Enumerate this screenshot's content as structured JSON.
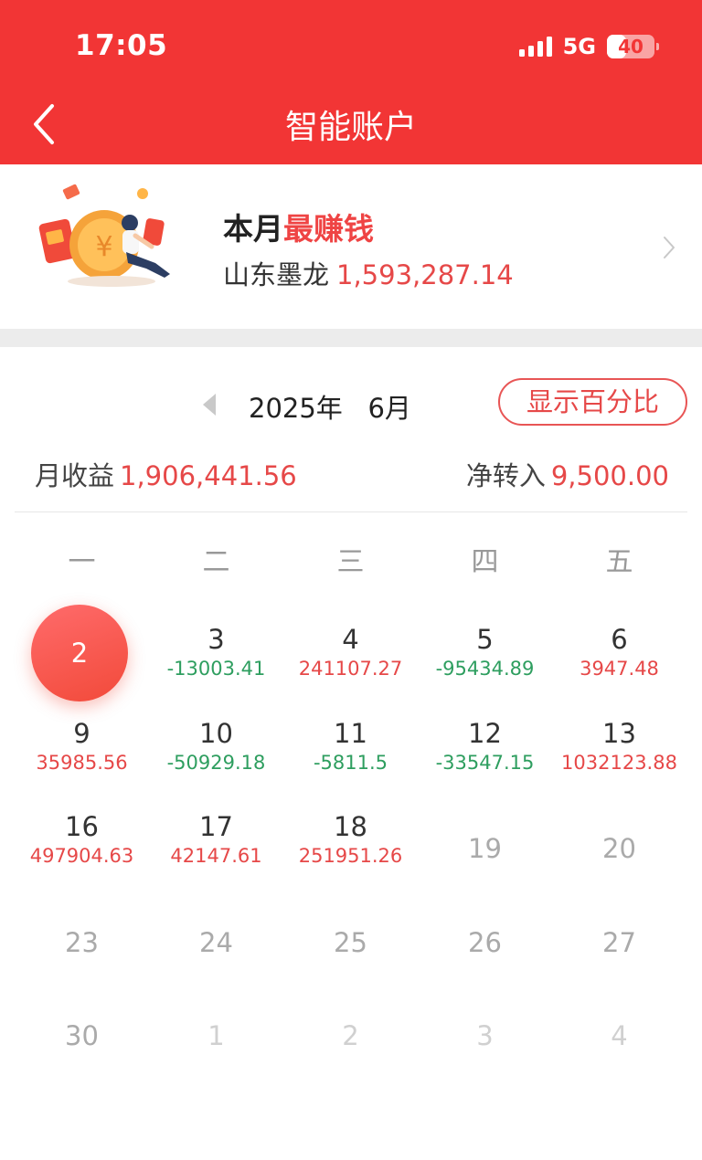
{
  "status": {
    "time": "17:05",
    "network": "5G",
    "battery": "40",
    "battery_level": 0.4
  },
  "header": {
    "title": "智能账户"
  },
  "best": {
    "title_plain": "本月",
    "title_highlight": "最赚钱",
    "name": "山东墨龙",
    "amount": "1,593,287.14"
  },
  "month": {
    "label": "2025年   6月",
    "percent_button": "显示百分比"
  },
  "summary": {
    "income_label": "月收益",
    "income_value": "1,906,441.56",
    "transfer_label": "净转入",
    "transfer_value": "9,500.00"
  },
  "weekdays": [
    "一",
    "二",
    "三",
    "四",
    "五"
  ],
  "days": [
    {
      "day": "2",
      "pl": "",
      "state": "selected"
    },
    {
      "day": "3",
      "pl": "-13003.41",
      "state": "neg"
    },
    {
      "day": "4",
      "pl": "241107.27",
      "state": "pos"
    },
    {
      "day": "5",
      "pl": "-95434.89",
      "state": "neg"
    },
    {
      "day": "6",
      "pl": "3947.48",
      "state": "pos"
    },
    {
      "day": "9",
      "pl": "35985.56",
      "state": "pos"
    },
    {
      "day": "10",
      "pl": "-50929.18",
      "state": "neg"
    },
    {
      "day": "11",
      "pl": "-5811.5",
      "state": "neg"
    },
    {
      "day": "12",
      "pl": "-33547.15",
      "state": "neg"
    },
    {
      "day": "13",
      "pl": "1032123.88",
      "state": "pos"
    },
    {
      "day": "16",
      "pl": "497904.63",
      "state": "pos"
    },
    {
      "day": "17",
      "pl": "42147.61",
      "state": "pos"
    },
    {
      "day": "18",
      "pl": "251951.26",
      "state": "pos"
    },
    {
      "day": "19",
      "pl": "",
      "state": "future"
    },
    {
      "day": "20",
      "pl": "",
      "state": "future"
    },
    {
      "day": "23",
      "pl": "",
      "state": "future"
    },
    {
      "day": "24",
      "pl": "",
      "state": "future"
    },
    {
      "day": "25",
      "pl": "",
      "state": "future"
    },
    {
      "day": "26",
      "pl": "",
      "state": "future"
    },
    {
      "day": "27",
      "pl": "",
      "state": "future"
    },
    {
      "day": "30",
      "pl": "",
      "state": "future"
    },
    {
      "day": "1",
      "pl": "",
      "state": "next"
    },
    {
      "day": "2",
      "pl": "",
      "state": "next"
    },
    {
      "day": "3",
      "pl": "",
      "state": "next"
    },
    {
      "day": "4",
      "pl": "",
      "state": "next"
    }
  ],
  "colors": {
    "brand_red": "#f23535",
    "profit_red": "#e64848",
    "loss_green": "#2e9e5f"
  },
  "icons": {
    "back": "chevron-left-icon",
    "card_arrow": "chevron-right-icon",
    "prev_month": "triangle-left-icon"
  }
}
